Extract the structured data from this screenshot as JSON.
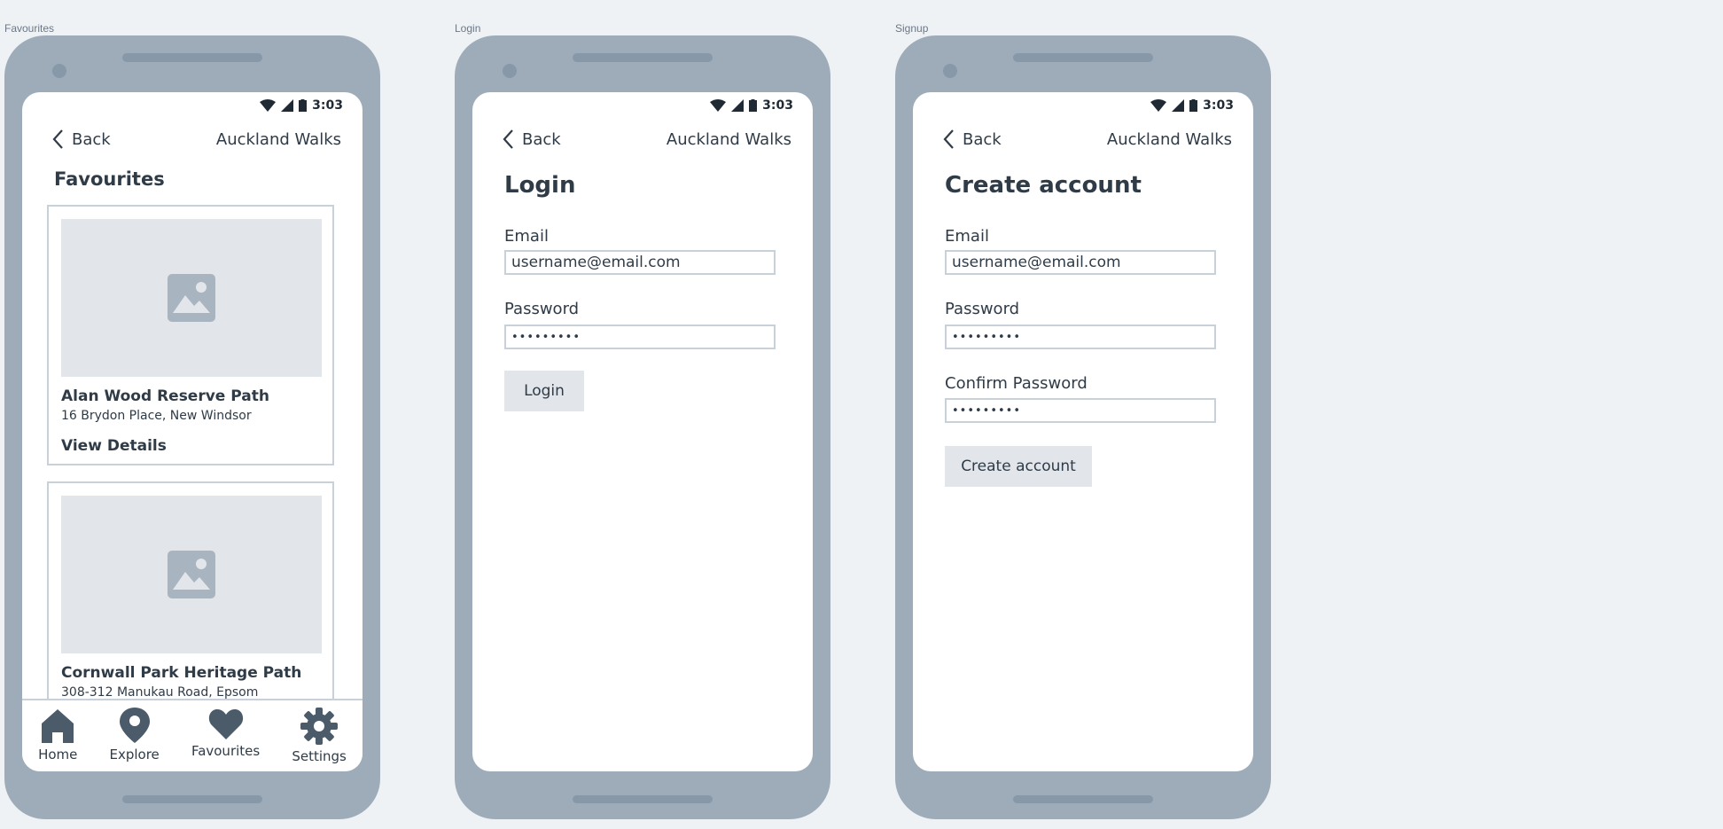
{
  "frames": {
    "favourites": {
      "label": "Favourites"
    },
    "login": {
      "label": "Login"
    },
    "signup": {
      "label": "Signup"
    }
  },
  "status": {
    "time": "3:03"
  },
  "appbar": {
    "back_label": "Back",
    "app_title": "Auckland Walks"
  },
  "favourites": {
    "title": "Favourites",
    "cards": [
      {
        "title": "Alan Wood Reserve Path",
        "address": "16 Brydon Place, New Windsor",
        "details": "View Details"
      },
      {
        "title": "Cornwall Park Heritage Path",
        "address": "308-312 Manukau Road, Epsom"
      }
    ],
    "tabs": [
      "Home",
      "Explore",
      "Favourites",
      "Settings"
    ]
  },
  "login": {
    "title": "Login",
    "email_label": "Email",
    "email_value": "username@email.com",
    "password_label": "Password",
    "password_value": "•••••••••",
    "button": "Login"
  },
  "signup": {
    "title": "Create account",
    "email_label": "Email",
    "email_value": "username@email.com",
    "password_label": "Password",
    "password_value": "•••••••••",
    "confirm_label": "Confirm Password",
    "confirm_value": "•••••••••",
    "button": "Create account"
  },
  "colors": {
    "background": "#eef2f5",
    "device": "#9eacb9",
    "text": "#2f3b47",
    "placeholder": "#e2e6ea",
    "border": "#c8d1da"
  }
}
